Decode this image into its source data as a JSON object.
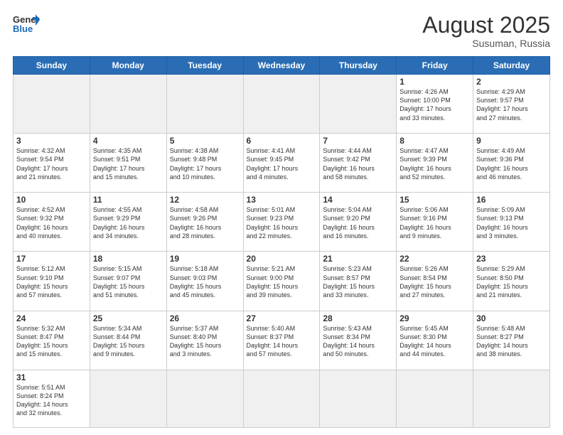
{
  "header": {
    "logo_general": "General",
    "logo_blue": "Blue",
    "month_year": "August 2025",
    "location": "Susuman, Russia"
  },
  "weekdays": [
    "Sunday",
    "Monday",
    "Tuesday",
    "Wednesday",
    "Thursday",
    "Friday",
    "Saturday"
  ],
  "weeks": [
    [
      {
        "day": "",
        "info": ""
      },
      {
        "day": "",
        "info": ""
      },
      {
        "day": "",
        "info": ""
      },
      {
        "day": "",
        "info": ""
      },
      {
        "day": "",
        "info": ""
      },
      {
        "day": "1",
        "info": "Sunrise: 4:26 AM\nSunset: 10:00 PM\nDaylight: 17 hours\nand 33 minutes."
      },
      {
        "day": "2",
        "info": "Sunrise: 4:29 AM\nSunset: 9:57 PM\nDaylight: 17 hours\nand 27 minutes."
      }
    ],
    [
      {
        "day": "3",
        "info": "Sunrise: 4:32 AM\nSunset: 9:54 PM\nDaylight: 17 hours\nand 21 minutes."
      },
      {
        "day": "4",
        "info": "Sunrise: 4:35 AM\nSunset: 9:51 PM\nDaylight: 17 hours\nand 15 minutes."
      },
      {
        "day": "5",
        "info": "Sunrise: 4:38 AM\nSunset: 9:48 PM\nDaylight: 17 hours\nand 10 minutes."
      },
      {
        "day": "6",
        "info": "Sunrise: 4:41 AM\nSunset: 9:45 PM\nDaylight: 17 hours\nand 4 minutes."
      },
      {
        "day": "7",
        "info": "Sunrise: 4:44 AM\nSunset: 9:42 PM\nDaylight: 16 hours\nand 58 minutes."
      },
      {
        "day": "8",
        "info": "Sunrise: 4:47 AM\nSunset: 9:39 PM\nDaylight: 16 hours\nand 52 minutes."
      },
      {
        "day": "9",
        "info": "Sunrise: 4:49 AM\nSunset: 9:36 PM\nDaylight: 16 hours\nand 46 minutes."
      }
    ],
    [
      {
        "day": "10",
        "info": "Sunrise: 4:52 AM\nSunset: 9:32 PM\nDaylight: 16 hours\nand 40 minutes."
      },
      {
        "day": "11",
        "info": "Sunrise: 4:55 AM\nSunset: 9:29 PM\nDaylight: 16 hours\nand 34 minutes."
      },
      {
        "day": "12",
        "info": "Sunrise: 4:58 AM\nSunset: 9:26 PM\nDaylight: 16 hours\nand 28 minutes."
      },
      {
        "day": "13",
        "info": "Sunrise: 5:01 AM\nSunset: 9:23 PM\nDaylight: 16 hours\nand 22 minutes."
      },
      {
        "day": "14",
        "info": "Sunrise: 5:04 AM\nSunset: 9:20 PM\nDaylight: 16 hours\nand 16 minutes."
      },
      {
        "day": "15",
        "info": "Sunrise: 5:06 AM\nSunset: 9:16 PM\nDaylight: 16 hours\nand 9 minutes."
      },
      {
        "day": "16",
        "info": "Sunrise: 5:09 AM\nSunset: 9:13 PM\nDaylight: 16 hours\nand 3 minutes."
      }
    ],
    [
      {
        "day": "17",
        "info": "Sunrise: 5:12 AM\nSunset: 9:10 PM\nDaylight: 15 hours\nand 57 minutes."
      },
      {
        "day": "18",
        "info": "Sunrise: 5:15 AM\nSunset: 9:07 PM\nDaylight: 15 hours\nand 51 minutes."
      },
      {
        "day": "19",
        "info": "Sunrise: 5:18 AM\nSunset: 9:03 PM\nDaylight: 15 hours\nand 45 minutes."
      },
      {
        "day": "20",
        "info": "Sunrise: 5:21 AM\nSunset: 9:00 PM\nDaylight: 15 hours\nand 39 minutes."
      },
      {
        "day": "21",
        "info": "Sunrise: 5:23 AM\nSunset: 8:57 PM\nDaylight: 15 hours\nand 33 minutes."
      },
      {
        "day": "22",
        "info": "Sunrise: 5:26 AM\nSunset: 8:54 PM\nDaylight: 15 hours\nand 27 minutes."
      },
      {
        "day": "23",
        "info": "Sunrise: 5:29 AM\nSunset: 8:50 PM\nDaylight: 15 hours\nand 21 minutes."
      }
    ],
    [
      {
        "day": "24",
        "info": "Sunrise: 5:32 AM\nSunset: 8:47 PM\nDaylight: 15 hours\nand 15 minutes."
      },
      {
        "day": "25",
        "info": "Sunrise: 5:34 AM\nSunset: 8:44 PM\nDaylight: 15 hours\nand 9 minutes."
      },
      {
        "day": "26",
        "info": "Sunrise: 5:37 AM\nSunset: 8:40 PM\nDaylight: 15 hours\nand 3 minutes."
      },
      {
        "day": "27",
        "info": "Sunrise: 5:40 AM\nSunset: 8:37 PM\nDaylight: 14 hours\nand 57 minutes."
      },
      {
        "day": "28",
        "info": "Sunrise: 5:43 AM\nSunset: 8:34 PM\nDaylight: 14 hours\nand 50 minutes."
      },
      {
        "day": "29",
        "info": "Sunrise: 5:45 AM\nSunset: 8:30 PM\nDaylight: 14 hours\nand 44 minutes."
      },
      {
        "day": "30",
        "info": "Sunrise: 5:48 AM\nSunset: 8:27 PM\nDaylight: 14 hours\nand 38 minutes."
      }
    ],
    [
      {
        "day": "31",
        "info": "Sunrise: 5:51 AM\nSunset: 8:24 PM\nDaylight: 14 hours\nand 32 minutes."
      },
      {
        "day": "",
        "info": ""
      },
      {
        "day": "",
        "info": ""
      },
      {
        "day": "",
        "info": ""
      },
      {
        "day": "",
        "info": ""
      },
      {
        "day": "",
        "info": ""
      },
      {
        "day": "",
        "info": ""
      }
    ]
  ]
}
